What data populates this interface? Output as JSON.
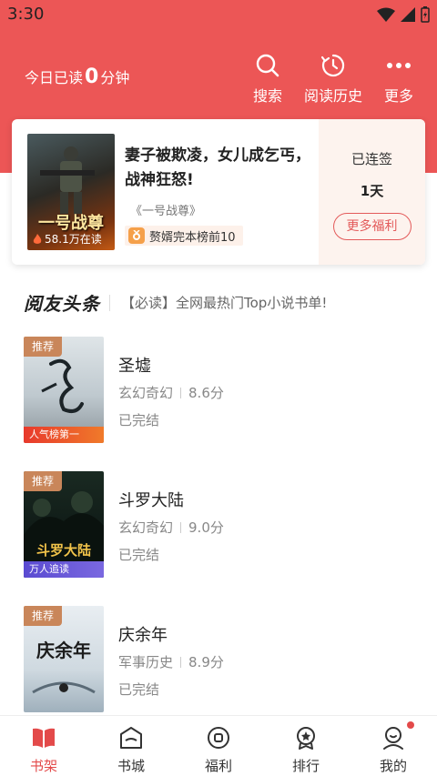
{
  "status_bar": {
    "time": "3:30"
  },
  "header": {
    "today_prefix": "今日已读",
    "today_minutes": "0",
    "today_suffix": "分钟",
    "search_label": "搜索",
    "history_label": "阅读历史",
    "more_label": "更多"
  },
  "featured": {
    "title": "妻子被欺凌，女儿成乞丐，战神狂怒!",
    "cover_text": "一号战尊",
    "readers": "58.1万在读",
    "book_name": "《一号战尊》",
    "rank": "赘婿完本榜前10",
    "signed_label": "已连签",
    "signed_days": "1天",
    "welfare_button": "更多福利"
  },
  "headline": {
    "brand": "阅友头条",
    "text": "【必读】全网最热门Top小说书单!"
  },
  "books": [
    {
      "tag": "推荐",
      "cover_label": "人气榜第一",
      "name": "圣墟",
      "genre": "玄幻奇幻",
      "score": "8.6分",
      "status": "已完结"
    },
    {
      "tag": "推荐",
      "cover_label": "万人追读",
      "name": "斗罗大陆",
      "genre": "玄幻奇幻",
      "score": "9.0分",
      "status": "已完结"
    },
    {
      "tag": "推荐",
      "cover_label": "",
      "name": "庆余年",
      "genre": "军事历史",
      "score": "8.9分",
      "status": "已完结"
    }
  ],
  "nav": [
    {
      "label": "书架",
      "icon": "bookshelf-icon",
      "active": true
    },
    {
      "label": "书城",
      "icon": "bookstore-icon",
      "active": false
    },
    {
      "label": "福利",
      "icon": "welfare-icon",
      "active": false
    },
    {
      "label": "排行",
      "icon": "ranking-icon",
      "active": false
    },
    {
      "label": "我的",
      "icon": "profile-icon",
      "active": false
    }
  ],
  "colors": {
    "accent": "#ec5656",
    "active_nav": "#e34a4a"
  }
}
